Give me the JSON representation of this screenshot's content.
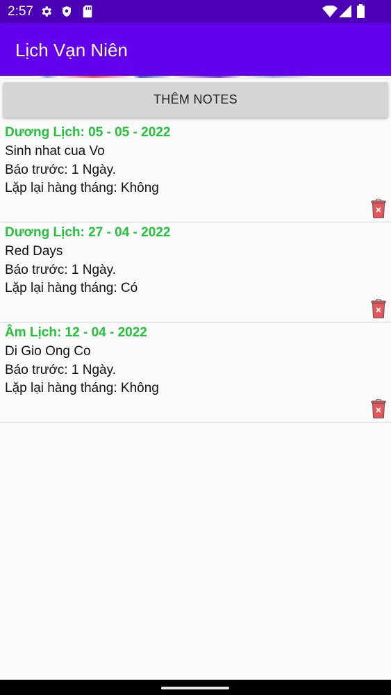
{
  "status": {
    "time": "2:57",
    "icons": [
      "settings-icon",
      "shield-icon",
      "sd-card-icon",
      "wifi-icon",
      "signal-icon",
      "battery-icon"
    ]
  },
  "app": {
    "title": "Lịch Vạn Niên",
    "accent": "#6200ee",
    "status_bar_color": "#4b00b5"
  },
  "add_button": {
    "label": "THÊM NOTES"
  },
  "notes": [
    {
      "date": "Dương Lịch: 05 - 05 - 2022",
      "title": "Sinh nhat cua Vo",
      "remind": "Báo trước: 1 Ngày.",
      "repeat": "Lặp lại hàng tháng: Không"
    },
    {
      "date": "Dương Lịch: 27 - 04 - 2022",
      "title": "Red Days",
      "remind": "Báo trước: 1 Ngày.",
      "repeat": "Lặp lại hàng tháng: Có"
    },
    {
      "date": "Âm Lịch: 12 - 04 - 2022",
      "title": "Di Gio Ong Co",
      "remind": "Báo trước: 1 Ngày.",
      "repeat": "Lặp lại hàng tháng: Không"
    }
  ],
  "colors": {
    "date_green": "#22c23a",
    "delete_red": "#e8555a"
  }
}
